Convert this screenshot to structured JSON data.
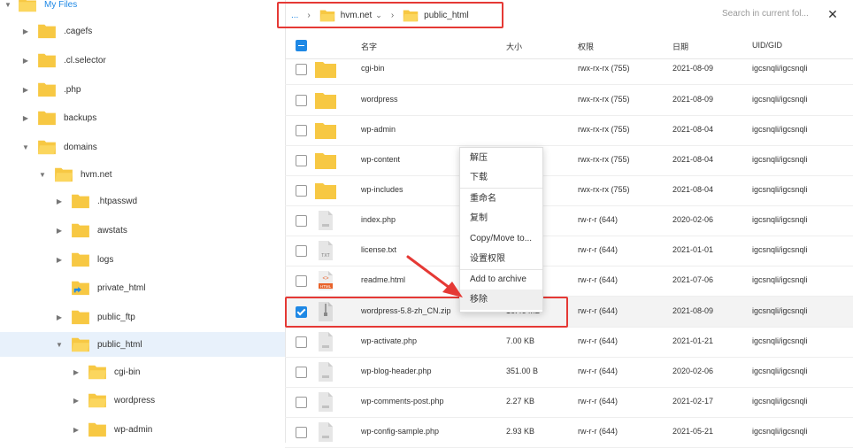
{
  "sidebar": {
    "root_label": "My Files",
    "items": [
      {
        "label": ".cagefs"
      },
      {
        "label": ".cl.selector"
      },
      {
        "label": ".php"
      },
      {
        "label": "backups"
      },
      {
        "label": "domains"
      },
      {
        "label": "hvm.net"
      },
      {
        "label": ".htpasswd"
      },
      {
        "label": "awstats"
      },
      {
        "label": "logs"
      },
      {
        "label": "private_html"
      },
      {
        "label": "public_ftp"
      },
      {
        "label": "public_html"
      },
      {
        "label": "cgi-bin"
      },
      {
        "label": "wordpress"
      },
      {
        "label": "wp-admin"
      }
    ]
  },
  "breadcrumb": {
    "ellipsis": "...",
    "domain": "hvm.net",
    "domain_caret": "⌄",
    "current": "public_html",
    "sep": "›"
  },
  "search": {
    "placeholder": "Search in current fol..."
  },
  "close_icon": "✕",
  "table": {
    "headers": {
      "name": "名字",
      "size": "大小",
      "perm": "权限",
      "date": "日期",
      "uid": "UID/GID"
    },
    "rows": [
      {
        "name": "cgi-bin",
        "size": "",
        "perm": "rwx-rx-rx (755)",
        "date": "2021-08-09",
        "uid": "igcsnqli/igcsnqli",
        "type": "folder"
      },
      {
        "name": "wordpress",
        "size": "",
        "perm": "rwx-rx-rx (755)",
        "date": "2021-08-09",
        "uid": "igcsnqli/igcsnqli",
        "type": "folder"
      },
      {
        "name": "wp-admin",
        "size": "",
        "perm": "rwx-rx-rx (755)",
        "date": "2021-08-04",
        "uid": "igcsnqli/igcsnqli",
        "type": "folder"
      },
      {
        "name": "wp-content",
        "size": "",
        "perm": "rwx-rx-rx (755)",
        "date": "2021-08-04",
        "uid": "igcsnqli/igcsnqli",
        "type": "folder"
      },
      {
        "name": "wp-includes",
        "size": "",
        "perm": "rwx-rx-rx (755)",
        "date": "2021-08-04",
        "uid": "igcsnqli/igcsnqli",
        "type": "folder"
      },
      {
        "name": "index.php",
        "size": "",
        "perm": "rw-r-r (644)",
        "date": "2020-02-06",
        "uid": "igcsnqli/igcsnqli",
        "type": "file"
      },
      {
        "name": "license.txt",
        "size": "",
        "perm": "rw-r-r (644)",
        "date": "2021-01-01",
        "uid": "igcsnqli/igcsnqli",
        "type": "txt"
      },
      {
        "name": "readme.html",
        "size": "",
        "perm": "rw-r-r (644)",
        "date": "2021-07-06",
        "uid": "igcsnqli/igcsnqli",
        "type": "html"
      },
      {
        "name": "wordpress-5.8-zh_CN.zip",
        "size": "16.46 MB",
        "perm": "rw-r-r (644)",
        "date": "2021-08-09",
        "uid": "igcsnqli/igcsnqli",
        "type": "zip"
      },
      {
        "name": "wp-activate.php",
        "size": "7.00 KB",
        "perm": "rw-r-r (644)",
        "date": "2021-01-21",
        "uid": "igcsnqli/igcsnqli",
        "type": "file"
      },
      {
        "name": "wp-blog-header.php",
        "size": "351.00 B",
        "perm": "rw-r-r (644)",
        "date": "2020-02-06",
        "uid": "igcsnqli/igcsnqli",
        "type": "file"
      },
      {
        "name": "wp-comments-post.php",
        "size": "2.27 KB",
        "perm": "rw-r-r (644)",
        "date": "2021-02-17",
        "uid": "igcsnqli/igcsnqli",
        "type": "file"
      },
      {
        "name": "wp-config-sample.php",
        "size": "2.93 KB",
        "perm": "rw-r-r (644)",
        "date": "2021-05-21",
        "uid": "igcsnqli/igcsnqli",
        "type": "file"
      }
    ]
  },
  "context_menu": {
    "items": [
      "解压",
      "下载",
      "重命名",
      "复制",
      "Copy/Move to...",
      "设置权限",
      "Add to archive",
      "移除"
    ]
  },
  "badges": {
    "txt": "TXT",
    "html": "HTML",
    "html_code": "<>"
  },
  "colors": {
    "accent": "#1e88e5",
    "folder": "#f7c843",
    "annotation": "#e53935"
  }
}
